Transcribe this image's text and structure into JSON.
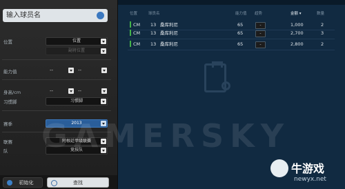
{
  "filters": {
    "search_placeholder": "输入球员名",
    "position_label": "位置",
    "position_value": "位置",
    "position_sub_value": "副将位置",
    "ability_label": "能力值",
    "ability_min": "--",
    "ability_max": "--",
    "height_label": "身高/cm",
    "height_min": "--",
    "height_max": "--",
    "foot_label": "习惯脚",
    "foot_value": "习惯脚",
    "season_label": "赛季",
    "season_value": "2013",
    "league_label": "联赛",
    "league_value": "阿根廷甲级联赛",
    "team_label": "队",
    "team_value": "竞技队",
    "reset_label": "初始化",
    "find_label": "查找"
  },
  "table": {
    "headers": [
      "位置",
      "球员名",
      "能力值",
      "趋势",
      "金额",
      "数量"
    ],
    "sort_icon": "chevron-down-icon",
    "rows": [
      {
        "position": "CM",
        "number": "13",
        "name": "桑库利尼",
        "ability": "65",
        "trend": "-",
        "amount": "1,000",
        "count": "2"
      },
      {
        "position": "CM",
        "number": "13",
        "name": "桑库利尼",
        "ability": "65",
        "trend": "-",
        "amount": "2,700",
        "count": "3"
      },
      {
        "position": "CM",
        "number": "13",
        "name": "桑库利尼",
        "ability": "65",
        "trend": "-",
        "amount": "2,800",
        "count": "2"
      }
    ]
  },
  "overlay": {
    "watermark": "GAMERSKY",
    "site_name": "牛游戏",
    "site_url": "newyx.net"
  },
  "colors": {
    "accent": "#2a5e9a",
    "position_marker": "#43b34a",
    "panel_bg": "#112a41"
  }
}
